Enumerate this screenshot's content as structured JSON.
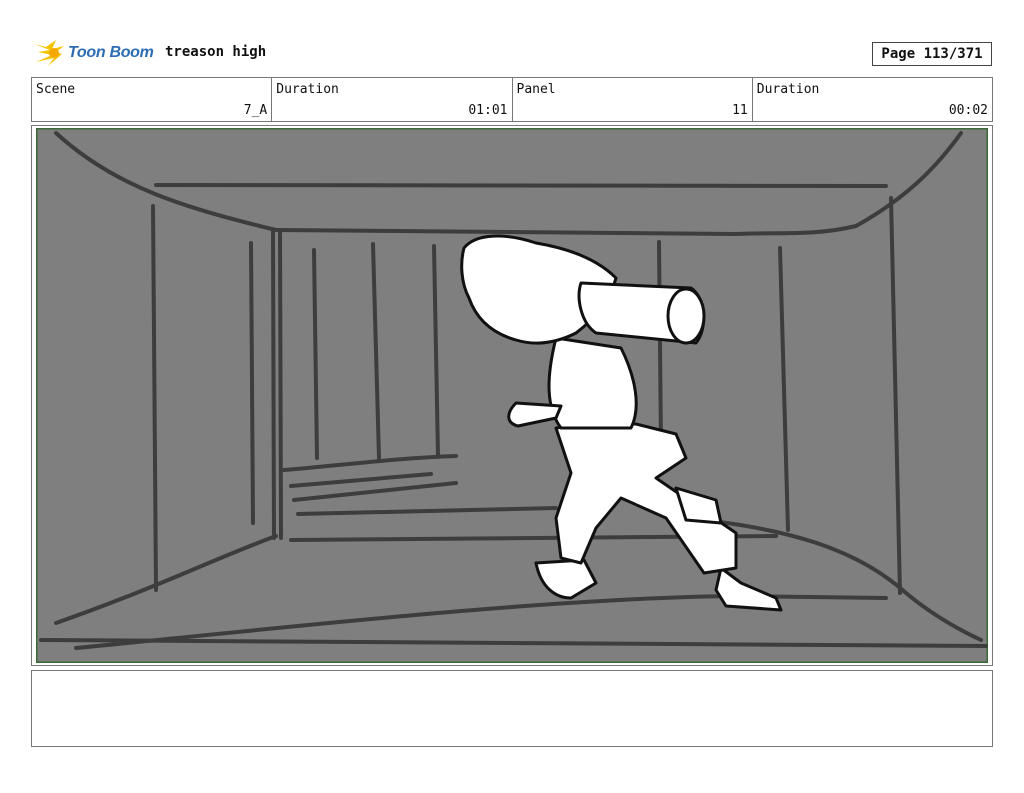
{
  "header": {
    "logo_text": "Toon Boom",
    "project_title": "treason high",
    "page_label": "Page 113/371"
  },
  "info": {
    "scene_label": "Scene",
    "scene_value": "7_A",
    "scene_duration_label": "Duration",
    "scene_duration_value": "01:01",
    "panel_label": "Panel",
    "panel_value": "11",
    "panel_duration_label": "Duration",
    "panel_duration_value": "00:02"
  },
  "notes": {
    "text": ""
  },
  "colors": {
    "panel_bg": "#7f7f7f",
    "panel_border": "#3a6b35",
    "logo_blue": "#2e6db4",
    "logo_yellow": "#f5c400"
  }
}
